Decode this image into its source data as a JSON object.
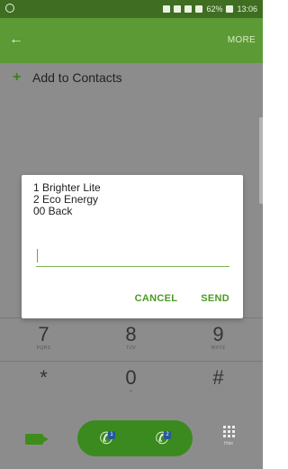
{
  "status_bar": {
    "battery": "62%",
    "time": "13:06"
  },
  "app_bar": {
    "back_icon": "arrow-left-icon",
    "more_label": "MORE"
  },
  "add_to_contacts": {
    "icon": "plus-icon",
    "label": "Add to Contacts"
  },
  "dialog": {
    "message": "1 Brighter Lite\n2 Eco Energy\n00 Back",
    "input_value": "",
    "cancel_label": "CANCEL",
    "send_label": "SEND",
    "accent_color": "#4c9a26"
  },
  "keypad": {
    "rows": [
      [
        {
          "digit": "7",
          "letters": "PQRS"
        },
        {
          "digit": "8",
          "letters": "TUV"
        },
        {
          "digit": "9",
          "letters": "WXYZ"
        }
      ],
      [
        {
          "digit": "*",
          "letters": ""
        },
        {
          "digit": "0",
          "letters": "+"
        },
        {
          "digit": "#",
          "letters": ""
        }
      ]
    ]
  },
  "call_bar": {
    "video_icon": "video-call-icon",
    "sim1_badge": "1",
    "sim2_badge": "2",
    "hide_label": "Hide",
    "brand_green": "#3b8a1f"
  }
}
